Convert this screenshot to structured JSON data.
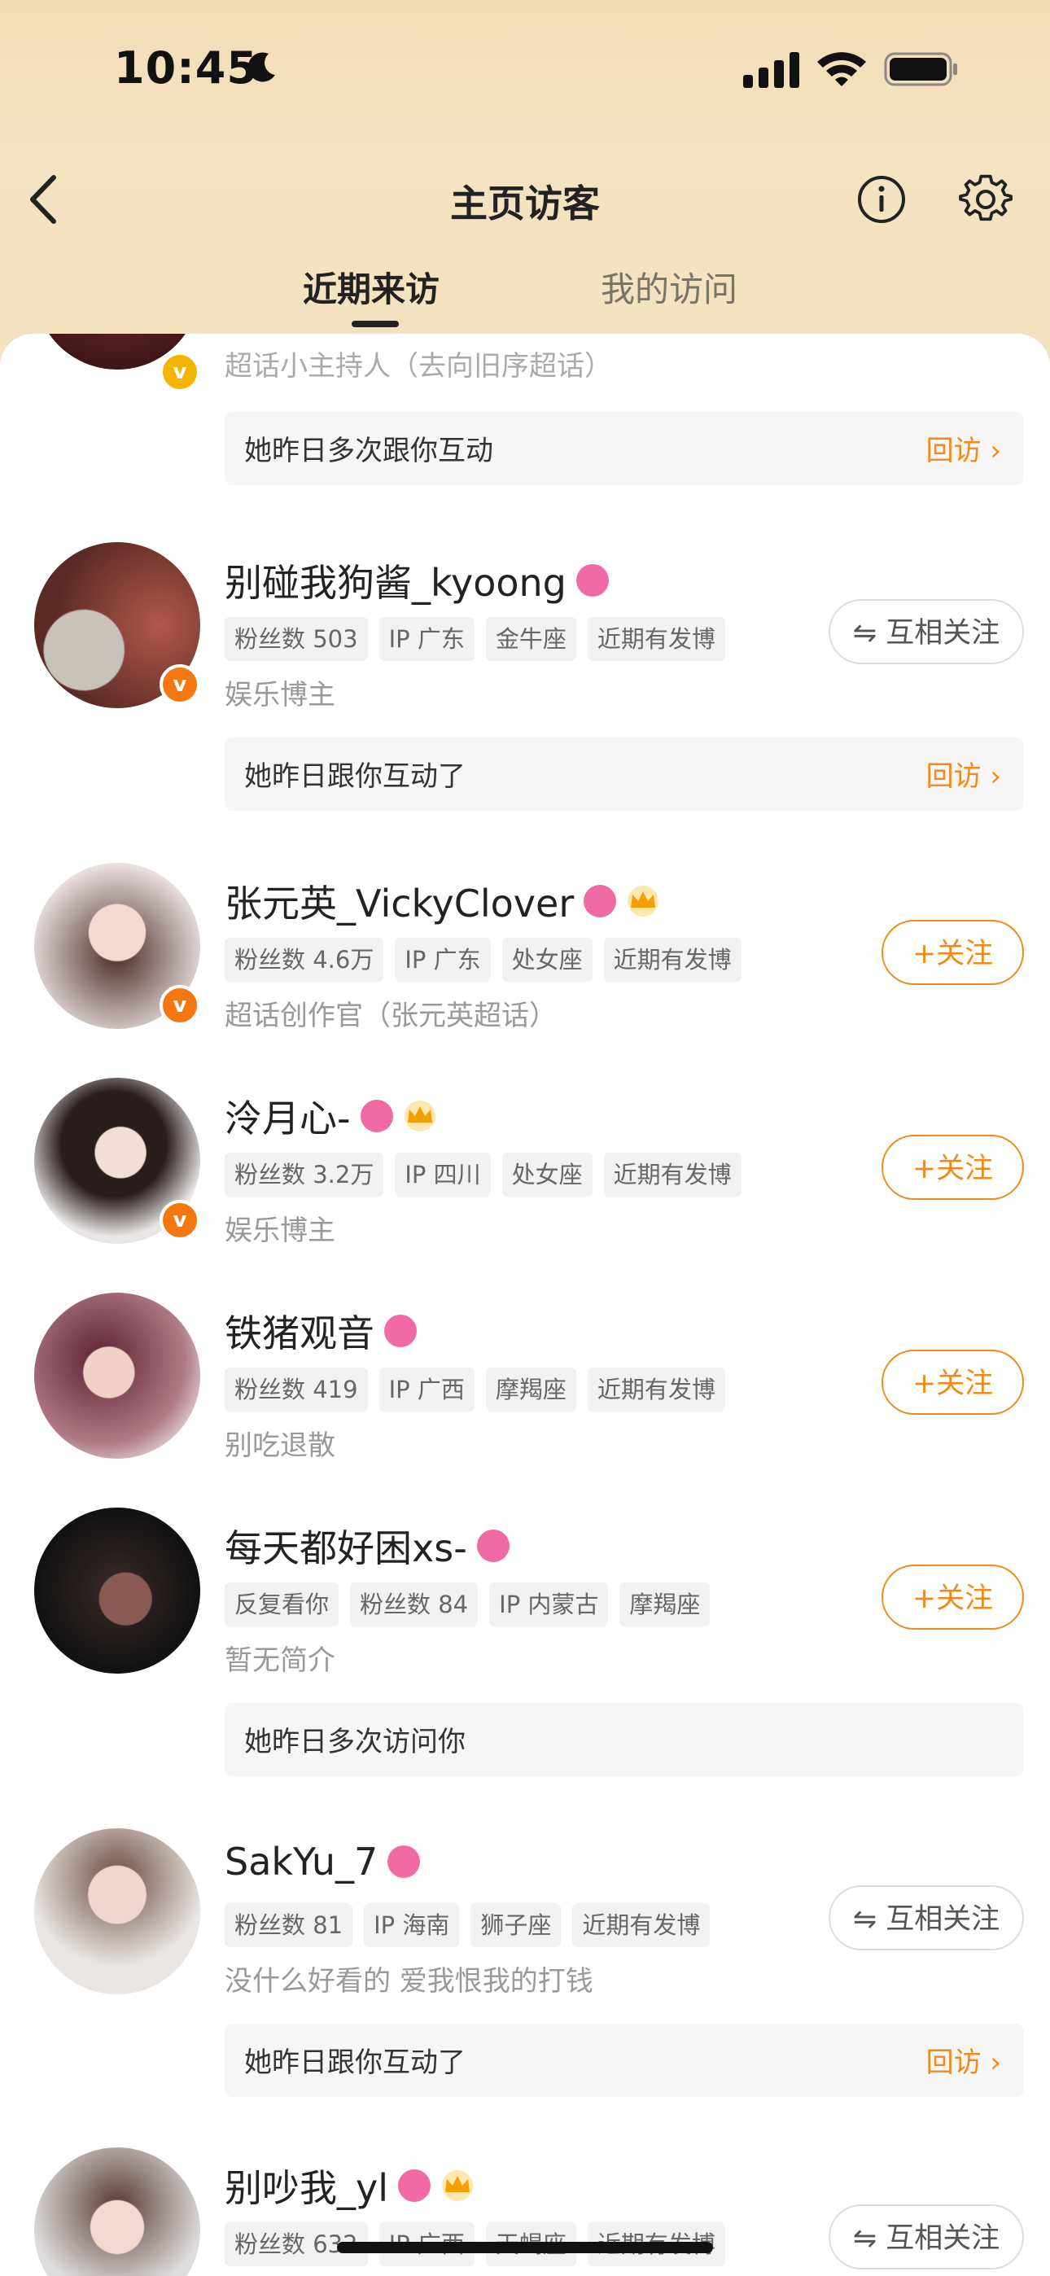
{
  "status": {
    "time": "10:45"
  },
  "header": {
    "title": "主页访客"
  },
  "tabs": [
    {
      "label": "近期来访"
    },
    {
      "label": "我的访问"
    }
  ],
  "top_partial": {
    "bio": "超话小主持人（去向旧序超话）",
    "note": "她昨日多次跟你互动",
    "note_link": "回访 ›"
  },
  "visitors": [
    {
      "name": "别碰我狗酱_kyoong",
      "tags": [
        "粉丝数 503",
        "IP 广东",
        "金牛座",
        "近期有发博"
      ],
      "bio": "娱乐博主",
      "action": "⇋ 互相关注",
      "note": "她昨日跟你互动了",
      "note_link": "回访 ›"
    },
    {
      "name": "张元英_VickyClover",
      "tags": [
        "粉丝数 4.6万",
        "IP 广东",
        "处女座",
        "近期有发博"
      ],
      "bio": "超话创作官（张元英超话）",
      "action": "+关注"
    },
    {
      "name": "泠月心-",
      "tags": [
        "粉丝数 3.2万",
        "IP 四川",
        "处女座",
        "近期有发博"
      ],
      "bio": "娱乐博主",
      "action": "+关注"
    },
    {
      "name": "铁猪观音",
      "tags": [
        "粉丝数 419",
        "IP 广西",
        "摩羯座",
        "近期有发博"
      ],
      "bio": "别吃退散",
      "action": "+关注"
    },
    {
      "name": "每天都好困xs-",
      "tags": [
        "反复看你",
        "粉丝数 84",
        "IP 内蒙古",
        "摩羯座"
      ],
      "bio": "暂无简介",
      "action": "+关注",
      "note": "她昨日多次访问你"
    },
    {
      "name": "SakYu_7",
      "tags": [
        "粉丝数 81",
        "IP 海南",
        "狮子座",
        "近期有发博"
      ],
      "bio": "没什么好看的 爱我恨我的打钱",
      "action": "⇋ 互相关注",
      "note": "她昨日跟你互动了",
      "note_link": "回访 ›"
    },
    {
      "name": "别吵我_yl",
      "tags": [
        "粉丝数 632",
        "IP 广西",
        "天蝎座",
        "近期有发博"
      ],
      "action": "⇋ 互相关注"
    }
  ],
  "colors": {
    "accent": "#f28a19",
    "female_badge": "#f06aa6",
    "verified": "#f2780f"
  }
}
